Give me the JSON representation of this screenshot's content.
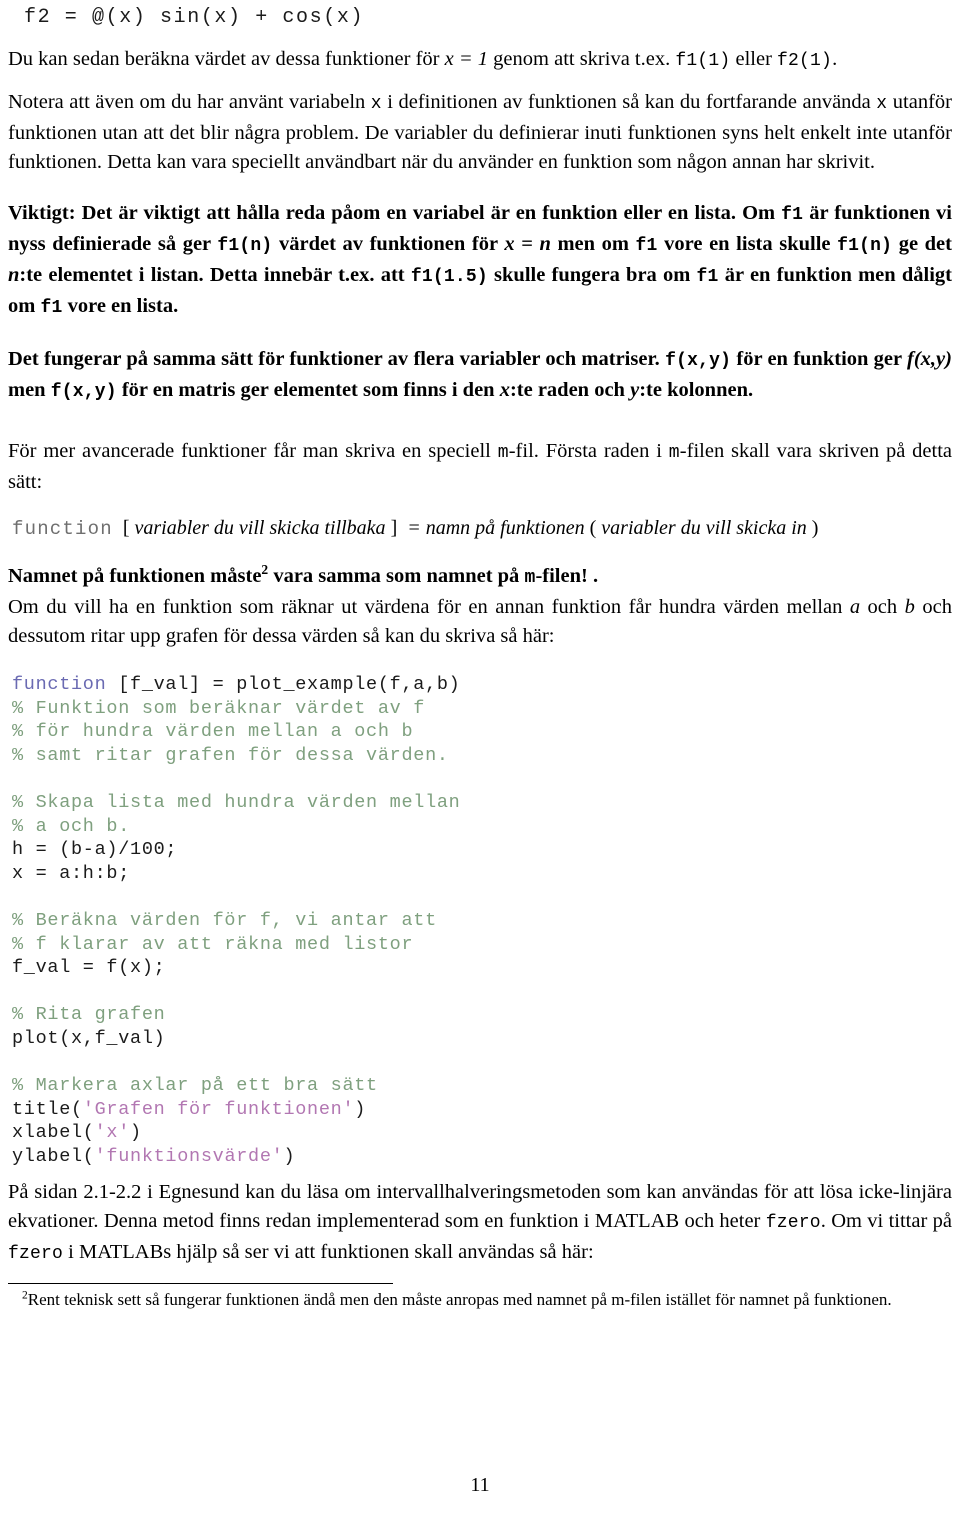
{
  "document": {
    "page_number": "11",
    "language": "sv",
    "colors": {
      "keyword": "#6a6ab2",
      "comment": "#7fa07f",
      "string": "#b277b2",
      "text": "#000000",
      "gray_mono": "#6f6f6f"
    }
  },
  "top_code_line": "f2 = @(x) sin(x) + cos(x)",
  "paragraphs": {
    "p1_part1": "Du kan sedan beräkna värdet av dessa funktioner för ",
    "p1_math": "x = 1",
    "p1_part2": " genom att skriva t.ex. ",
    "p1_code1": "f1(1)",
    "p1_part3": " eller ",
    "p1_code2": "f2(1)",
    "p1_part4": ".",
    "p2_part1": "Notera att även om du har använt variabeln ",
    "p2_code1": "x",
    "p2_part2": " i definitionen av funktionen så kan du fortfarande använda ",
    "p2_code2": "x",
    "p2_part3": " utanför funktionen utan att det blir några problem. De variabler du definierar inuti funktionen syns helt enkelt inte utanför funktionen. Detta kan vara speciellt användbart när du använder en funktion som någon annan har skrivit.",
    "p3_part1": "Viktigt: Det är viktigt att hålla reda påom en variabel är en funktion eller en lista. Om ",
    "p3_code1": "f1",
    "p3_part2": " är funktionen vi nyss definierade så ger ",
    "p3_code2": "f1(n)",
    "p3_part3": " värdet av funktionen för ",
    "p3_math1": "x = n",
    "p3_part4": " men om ",
    "p3_code3": "f1",
    "p3_part5": " vore en lista skulle ",
    "p3_code4": "f1(n)",
    "p3_part6": " ge det ",
    "p3_math2": "n",
    "p3_part7": ":te elementet i listan. Detta innebär t.ex. att ",
    "p3_code5": "f1(1.5)",
    "p3_part8": " skulle fungera bra om ",
    "p3_code6": "f1",
    "p3_part9": " är en funktion men dåligt om ",
    "p3_code7": "f1",
    "p3_part10": " vore en lista.",
    "p4_part1": "Det fungerar på samma sätt för funktioner av flera variabler och matriser. ",
    "p4_code1": "f(x,y)",
    "p4_part2": " för en funktion ger ",
    "p4_math1": "f(x,y)",
    "p4_part3": " men ",
    "p4_code2": "f(x,y)",
    "p4_part4": " för en matris ger elementet som finns i den ",
    "p4_math2": "x",
    "p4_part5": ":te raden och ",
    "p4_math3": "y",
    "p4_part6": ":te kolonnen.",
    "p5_part1": "För mer avancerade funktioner får man skriva en speciell ",
    "p5_code1": "m",
    "p5_part2": "-fil. Första raden i ",
    "p5_code2": "m",
    "p5_part3": "-filen skall vara skriven på detta sätt:",
    "p6_part1": "Namnet på funktionen måste",
    "p6_footnote_marker": "2",
    "p6_part2": " vara samma som namnet på ",
    "p6_code1": "m",
    "p6_part3": "-filen! .",
    "p7_part1": "Om du vill ha en funktion som räknar ut värdena för en annan funktion får hundra värden mellan ",
    "p7_math1": "a",
    "p7_part2": " och ",
    "p7_math2": "b",
    "p7_part3": " och dessutom ritar upp grafen för dessa värden så kan du skriva så här:",
    "p8_part1": "På sidan 2.1-2.2 i Egnesund kan du läsa om intervallhalveringsmetoden som kan användas för att lösa icke-linjära ekvationer. Denna metod finns redan implementerad som en funktion i MATLAB och heter ",
    "p8_code1": "fzero",
    "p8_part2": ". Om vi tittar på ",
    "p8_code2": "fzero",
    "p8_part3": " i MATLABs hjälp så ser vi att funktionen skall användas så här:"
  },
  "signature_line": {
    "keyword": "function",
    "open_bracket": "[",
    "out_args": "variabler du vill skicka tillbaka",
    "close_bracket": "]",
    "equals": "=",
    "fname": "namn på funktionen",
    "open_paren": "(",
    "in_args": "variabler du vill skicka in",
    "close_paren": ")"
  },
  "code_block": {
    "lines": [
      {
        "type": "code",
        "segments": [
          {
            "kind": "kw",
            "text": "function"
          },
          {
            "kind": "plain",
            "text": " [f_val] = plot_example(f,a,b)"
          }
        ]
      },
      {
        "type": "code",
        "segments": [
          {
            "kind": "cm",
            "text": "% Funktion som beräknar värdet av f"
          }
        ]
      },
      {
        "type": "code",
        "segments": [
          {
            "kind": "cm",
            "text": "% för hundra värden mellan a och b"
          }
        ]
      },
      {
        "type": "code",
        "segments": [
          {
            "kind": "cm",
            "text": "% samt ritar grafen för dessa värden."
          }
        ]
      },
      {
        "type": "blank",
        "segments": []
      },
      {
        "type": "code",
        "segments": [
          {
            "kind": "cm",
            "text": "% Skapa lista med hundra värden mellan"
          }
        ]
      },
      {
        "type": "code",
        "segments": [
          {
            "kind": "cm",
            "text": "% a och b."
          }
        ]
      },
      {
        "type": "code",
        "segments": [
          {
            "kind": "plain",
            "text": "h = (b-a)/100;"
          }
        ]
      },
      {
        "type": "code",
        "segments": [
          {
            "kind": "plain",
            "text": "x = a:h:b;"
          }
        ]
      },
      {
        "type": "blank",
        "segments": []
      },
      {
        "type": "code",
        "segments": [
          {
            "kind": "cm",
            "text": "% Beräkna värden för f, vi antar att"
          }
        ]
      },
      {
        "type": "code",
        "segments": [
          {
            "kind": "cm",
            "text": "% f klarar av att räkna med listor"
          }
        ]
      },
      {
        "type": "code",
        "segments": [
          {
            "kind": "plain",
            "text": "f_val = f(x);"
          }
        ]
      },
      {
        "type": "blank",
        "segments": []
      },
      {
        "type": "code",
        "segments": [
          {
            "kind": "cm",
            "text": "% Rita grafen"
          }
        ]
      },
      {
        "type": "code",
        "segments": [
          {
            "kind": "plain",
            "text": "plot(x,f_val)"
          }
        ]
      },
      {
        "type": "blank",
        "segments": []
      },
      {
        "type": "code",
        "segments": [
          {
            "kind": "cm",
            "text": "% Markera axlar på ett bra sätt"
          }
        ]
      },
      {
        "type": "code",
        "segments": [
          {
            "kind": "plain",
            "text": "title("
          },
          {
            "kind": "str",
            "text": "'Grafen för funktionen'"
          },
          {
            "kind": "plain",
            "text": ")"
          }
        ]
      },
      {
        "type": "code",
        "segments": [
          {
            "kind": "plain",
            "text": "xlabel("
          },
          {
            "kind": "str",
            "text": "'x'"
          },
          {
            "kind": "plain",
            "text": ")"
          }
        ]
      },
      {
        "type": "code",
        "segments": [
          {
            "kind": "plain",
            "text": "ylabel("
          },
          {
            "kind": "str",
            "text": "'funktionsvärde'"
          },
          {
            "kind": "plain",
            "text": ")"
          }
        ]
      }
    ]
  },
  "footnote": {
    "marker": "2",
    "text": "Rent teknisk sett så fungerar funktionen ändå men den måste anropas med namnet på m-filen istället för namnet på funktionen."
  }
}
